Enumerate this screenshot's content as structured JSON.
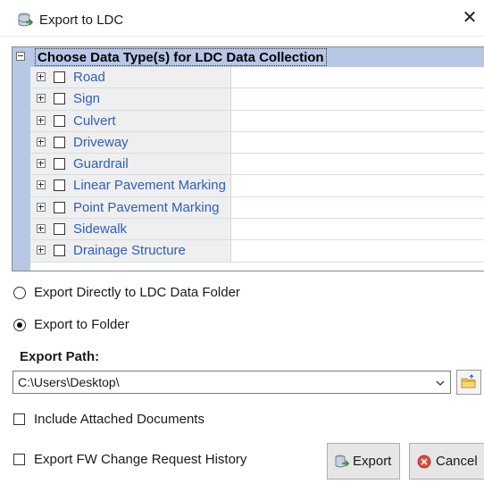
{
  "window": {
    "title": "Export to LDC",
    "close_glyph": "✕",
    "icon": "database-export-icon"
  },
  "tree": {
    "header": "Choose Data Type(s) for LDC Data Collection",
    "items": [
      {
        "label": "Road",
        "checked": false
      },
      {
        "label": "Sign",
        "checked": false
      },
      {
        "label": "Culvert",
        "checked": false
      },
      {
        "label": "Driveway",
        "checked": false
      },
      {
        "label": "Guardrail",
        "checked": false
      },
      {
        "label": "Linear Pavement Marking",
        "checked": false
      },
      {
        "label": "Point Pavement Marking",
        "checked": false
      },
      {
        "label": "Sidewalk",
        "checked": false
      },
      {
        "label": "Drainage Structure",
        "checked": false
      }
    ]
  },
  "export_options": {
    "direct_label": "Export Directly to LDC Data Folder",
    "folder_label": "Export to Folder",
    "selected": "folder"
  },
  "export_path": {
    "label": "Export Path:",
    "value": "C:\\Users\\Desktop\\"
  },
  "options": {
    "include_docs_label": "Include Attached Documents",
    "include_docs_checked": false,
    "fw_history_label": "Export FW Change Request History",
    "fw_history_checked": false
  },
  "buttons": {
    "export_label": "Export",
    "cancel_label": "Cancel"
  },
  "colors": {
    "tree_header_bg": "#b7c7e6",
    "tree_item_text": "#2f5fb8",
    "button_bg": "#e6e6e6"
  }
}
